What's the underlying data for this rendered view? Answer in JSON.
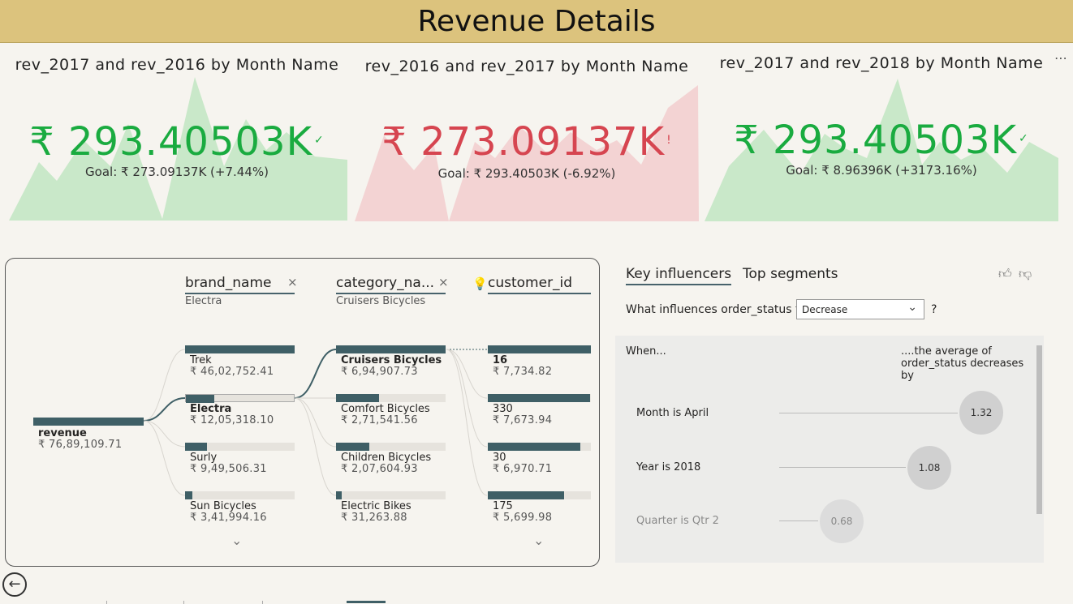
{
  "page": {
    "title": "Revenue Details"
  },
  "kpis": [
    {
      "title": "rev_2017 and rev_2016 by Month Name",
      "value": "₹ 293.40503K",
      "status_mark": "✓",
      "status": "good",
      "goal": "Goal: ₹ 273.09137K (+7.44%)"
    },
    {
      "title": "rev_2016 and rev_2017 by Month Name",
      "value": "₹ 273.09137K",
      "status_mark": "!",
      "status": "bad",
      "goal": "Goal: ₹ 293.40503K (-6.92%)"
    },
    {
      "title": "rev_2017 and rev_2018 by Month Name",
      "value": "₹ 293.40503K",
      "status_mark": "✓",
      "status": "good",
      "goal": "Goal: ₹ 8.96396K (+3173.16%)"
    }
  ],
  "colors": {
    "good": "#1aab40",
    "bad": "#d64550",
    "good_area": "#c9e8c9",
    "bad_area": "#f3d3d3",
    "bar": "#3f5f66",
    "header": "#dcc37d"
  },
  "decomp": {
    "columns": [
      {
        "name": "brand_name",
        "filter": "Electra",
        "close_icon": "×"
      },
      {
        "name": "category_na...",
        "filter": "Cruisers Bicycles",
        "close_icon": "×"
      },
      {
        "name": "customer_id",
        "filter": ""
      }
    ],
    "root": {
      "label": "revenue",
      "value": "₹ 76,89,109.71"
    },
    "brands": [
      {
        "label": "Trek",
        "value": "₹ 46,02,752.41",
        "fill": 1.0
      },
      {
        "label": "Electra",
        "value": "₹ 12,05,318.10",
        "fill": 0.26,
        "selected": true
      },
      {
        "label": "Surly",
        "value": "₹ 9,49,506.31",
        "fill": 0.2
      },
      {
        "label": "Sun Bicycles",
        "value": "₹ 3,41,994.16",
        "fill": 0.07
      }
    ],
    "categories": [
      {
        "label": "Cruisers Bicycles",
        "value": "₹ 6,94,907.73",
        "fill": 1.0,
        "selected": true
      },
      {
        "label": "Comfort Bicycles",
        "value": "₹ 2,71,541.56",
        "fill": 0.39
      },
      {
        "label": "Children Bicycles",
        "value": "₹ 2,07,604.93",
        "fill": 0.3
      },
      {
        "label": "Electric Bikes",
        "value": "₹ 31,263.88",
        "fill": 0.05
      }
    ],
    "customers": [
      {
        "label": "16",
        "value": "₹ 7,734.82",
        "fill": 1.0,
        "selected": true
      },
      {
        "label": "330",
        "value": "₹ 7,673.94",
        "fill": 0.99
      },
      {
        "label": "30",
        "value": "₹ 6,970.71",
        "fill": 0.9
      },
      {
        "label": "175",
        "value": "₹ 5,699.98",
        "fill": 0.74
      }
    ]
  },
  "key_influencers": {
    "tabs": [
      "Key influencers",
      "Top segments"
    ],
    "question": "What influences order_status to",
    "dropdown_value": "Decrease",
    "question_mark": "?",
    "when_label": "When...",
    "avg_label": "....the average of order_status decreases by",
    "rows": [
      {
        "label": "Month is April",
        "value": "1.32"
      },
      {
        "label": "Year is 2018",
        "value": "1.08"
      },
      {
        "label": "Quarter is Qtr 2",
        "value": "0.68"
      }
    ]
  }
}
